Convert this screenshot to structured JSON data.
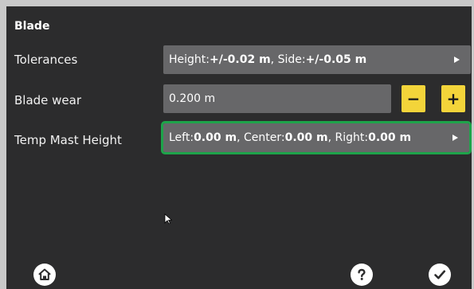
{
  "section": {
    "title": "Blade"
  },
  "rows": [
    {
      "label": "Tolerances",
      "parts": [
        {
          "label": "Height:",
          "value": "+/-0.02 m"
        },
        {
          "label": ", Side:",
          "value": "+/-0.05 m"
        }
      ]
    },
    {
      "label": "Blade wear",
      "value": "0.200 m",
      "minus": "−",
      "plus": "+"
    },
    {
      "label": "Temp Mast Height",
      "parts": [
        {
          "label": "Left:",
          "value": "0.00 m"
        },
        {
          "label": ", Center:",
          "value": "0.00 m"
        },
        {
          "label": ", Right:",
          "value": "0.00 m"
        }
      ]
    }
  ],
  "icons": {
    "home": "home-icon",
    "help": "help-icon",
    "confirm": "checkmark-icon",
    "cursor": "mouse-cursor-icon"
  },
  "colors": {
    "background": "#2c2c2d",
    "field": "#676769",
    "accent_yellow": "#f3d43a",
    "highlight_green": "#1ea34a"
  }
}
